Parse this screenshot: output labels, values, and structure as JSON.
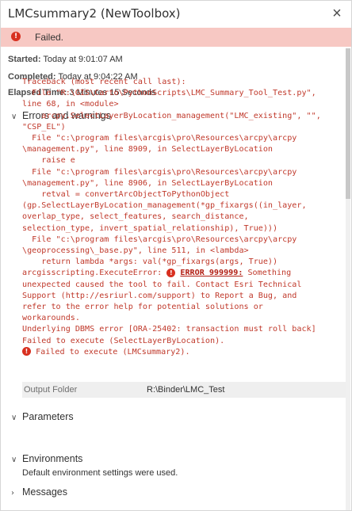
{
  "window": {
    "title": "LMCsummary2 (NewToolbox)",
    "close_glyph": "×"
  },
  "status": {
    "icon": "error-icon",
    "text": "Failed.",
    "color": "#f7c8c3"
  },
  "info": {
    "started_label": "Started:",
    "started_value": "Today at 9:01:07 AM",
    "completed_label": "Completed:",
    "completed_value": "Today at 9:04:22 AM",
    "elapsed_label": "Elapsed Time:",
    "elapsed_value": "3 Minutes 15 Seconds"
  },
  "errors_section": {
    "title": "Errors and warnings",
    "lines": [
      "Traceback (most recent call last):",
      "  File \"R:\\GIS\\Carto\\PythonScripts\\LMC_Summary_Tool_Test.py\",",
      "line 68, in <module>",
      "    arcpy.SelectLayerByLocation_management(\"LMC_existing\", \"\",",
      "\"CSP_EL\")",
      "  File \"c:\\program files\\arcgis\\pro\\Resources\\arcpy\\arcpy",
      "\\management.py\", line 8909, in SelectLayerByLocation",
      "    raise e",
      "  File \"c:\\program files\\arcgis\\pro\\Resources\\arcpy\\arcpy",
      "\\management.py\", line 8906, in SelectLayerByLocation",
      "    retval = convertArcObjectToPythonObject",
      "(gp.SelectLayerByLocation_management(*gp_fixargs((in_layer,",
      "overlap_type, select_features, search_distance,",
      "selection_type, invert_spatial_relationship), True)))",
      "  File \"c:\\program files\\arcgis\\pro\\Resources\\arcpy\\arcpy",
      "\\geoprocessing\\_base.py\", line 511, in <lambda>",
      "    return lambda *args: val(*gp_fixargs(args, True))"
    ],
    "exec_error_prefix": "arcgisscripting.ExecuteError: ",
    "error_code": "ERROR 999999:",
    "exec_error_suffix": " Something",
    "lines_after": [
      "unexpected caused the tool to fail. Contact Esri Technical",
      "Support (http://esriurl.com/support) to Report a Bug, and",
      "refer to the error help for potential solutions or",
      "workarounds.",
      "Underlying DBMS error [ORA-25402: transaction must roll back]",
      "Failed to execute (SelectLayerByLocation)."
    ],
    "final_error": "Failed to execute (LMCsummary2)."
  },
  "parameters_section": {
    "title": "Parameters",
    "rows": [
      {
        "name": "Output Folder",
        "value": "R:\\Binder\\LMC_Test"
      }
    ]
  },
  "environments_section": {
    "title": "Environments",
    "text": "Default environment settings were used."
  },
  "messages_section": {
    "title": "Messages"
  }
}
